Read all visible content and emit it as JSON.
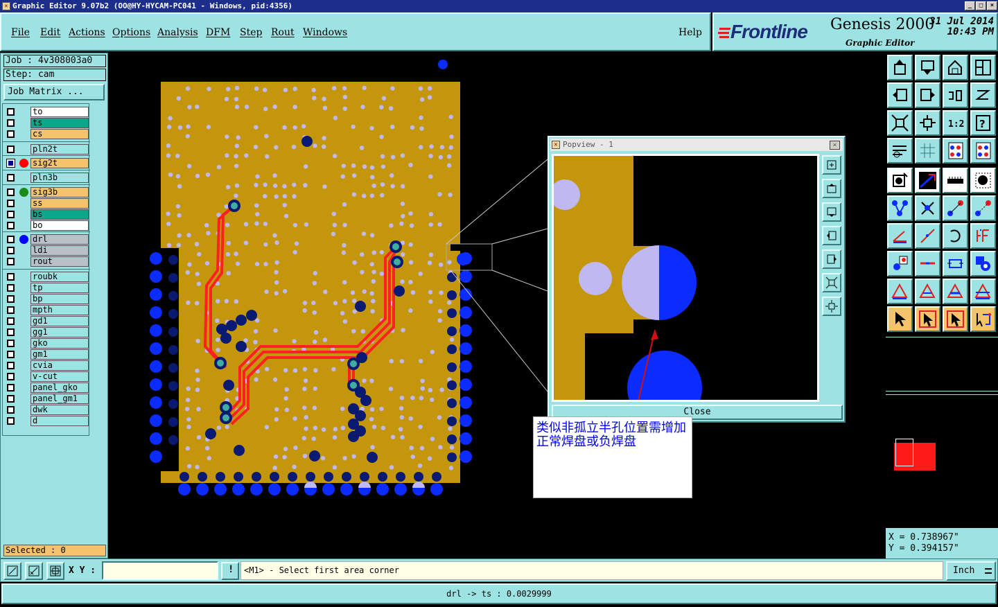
{
  "window": {
    "title": "Graphic Editor 9.07b2  (OO@HY-HYCAM-PC041 - Windows, pid:4356)",
    "app_icon": "app-icon",
    "min": "_",
    "max": "□",
    "close": "×"
  },
  "menu": [
    "File",
    "Edit",
    "Actions",
    "Options",
    "Analysis",
    "DFM",
    "Step",
    "Rout",
    "Windows"
  ],
  "help": "Help",
  "brand": {
    "logo": "Frontline",
    "product": "Genesis 2000",
    "subtitle": "Graphic Editor",
    "date": "31 Jul 2014",
    "time": "10:43 PM"
  },
  "job": {
    "job_label": "Job : 4v308003a0",
    "step_label": "Step: cam",
    "matrix_button": "Job Matrix ..."
  },
  "layers": [
    {
      "name": "to",
      "color": "#ffffff",
      "checked": false
    },
    {
      "name": "ts",
      "color": "#0aa88a",
      "checked": false
    },
    {
      "name": "cs",
      "color": "#f5c36b",
      "checked": false
    },
    {
      "name": "pln2t",
      "color": "#9ee3e3",
      "checked": false
    },
    {
      "name": "sig2t",
      "color": "#f5c36b",
      "checked": true,
      "dot": "#ff0000"
    },
    {
      "name": "pln3b",
      "color": "#9ee3e3",
      "checked": false
    },
    {
      "name": "sig3b",
      "color": "#f5c36b",
      "checked": false,
      "dot": "#1a8a1a"
    },
    {
      "name": "ss",
      "color": "#f5c36b",
      "checked": false
    },
    {
      "name": "bs",
      "color": "#0aa88a",
      "checked": false
    },
    {
      "name": "bo",
      "color": "#ffffff",
      "checked": false
    },
    {
      "name": "drl",
      "color": "#b8c0c8",
      "checked": false,
      "dot": "#0000ff"
    },
    {
      "name": "ldi",
      "color": "#b8c0c8",
      "checked": false
    },
    {
      "name": "rout",
      "color": "#b8c0c8",
      "checked": false
    },
    {
      "name": "roubk",
      "color": "#9ee3e3",
      "checked": false
    },
    {
      "name": "tp",
      "color": "#9ee3e3",
      "checked": false
    },
    {
      "name": "bp",
      "color": "#9ee3e3",
      "checked": false
    },
    {
      "name": "mpth",
      "color": "#9ee3e3",
      "checked": false
    },
    {
      "name": "gd1",
      "color": "#9ee3e3",
      "checked": false
    },
    {
      "name": "gg1",
      "color": "#9ee3e3",
      "checked": false
    },
    {
      "name": "gko",
      "color": "#9ee3e3",
      "checked": false
    },
    {
      "name": "gm1",
      "color": "#9ee3e3",
      "checked": false
    },
    {
      "name": "cvia",
      "color": "#9ee3e3",
      "checked": false
    },
    {
      "name": "v-cut",
      "color": "#9ee3e3",
      "checked": false
    },
    {
      "name": "panel_gko",
      "color": "#9ee3e3",
      "checked": false
    },
    {
      "name": "panel_gm1",
      "color": "#9ee3e3",
      "checked": false
    },
    {
      "name": "dwk",
      "color": "#9ee3e3",
      "checked": false
    },
    {
      "name": "d",
      "color": "#9ee3e3",
      "checked": false
    }
  ],
  "selected": "Selected : 0",
  "popview": {
    "title": "Popview - 1",
    "close_x": "×",
    "close_button": "Close"
  },
  "annotation": "类似非孤立半孔位置需增加正常焊盘或负焊盘",
  "coords": {
    "x": "X = 0.738967\"",
    "y": "Y = 0.394157\""
  },
  "cmd": {
    "xy_label": "X Y :",
    "xy_value": "",
    "alert_icon": "!",
    "prompt": "<M1> - Select first area corner",
    "units": "Inch"
  },
  "status": "drl -> ts : 0.0029999",
  "colors": {
    "copper": "#c4960c",
    "trace": "#ff2020",
    "pad": "#0b2bff",
    "via_dark": "#0a1a70",
    "hole": "#c0b8f0",
    "panel": "#9ee3e3"
  }
}
